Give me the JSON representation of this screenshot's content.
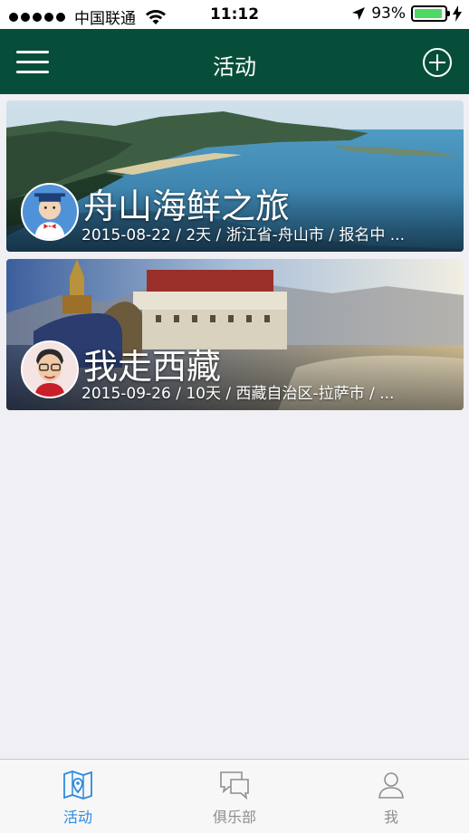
{
  "status_bar": {
    "carrier": "中国联通",
    "time": "11:12",
    "battery": "93%",
    "battery_level": 0.93
  },
  "nav": {
    "title": "活动",
    "menu_icon": "hamburger-icon",
    "add_icon": "plus-circle-icon"
  },
  "activities": [
    {
      "title": "舟山海鲜之旅",
      "meta": "2015-08-22 / 2天 /  浙江省-舟山市  /  报名中 ..."
    },
    {
      "title": "我走西藏",
      "meta": "2015-09-26 / 10天 /  西藏自治区-拉萨市  /  ..."
    }
  ],
  "tabs": [
    {
      "label": "活动",
      "icon": "map-pin-icon",
      "active": true
    },
    {
      "label": "俱乐部",
      "icon": "chat-bubbles-icon",
      "active": false
    },
    {
      "label": "我",
      "icon": "person-icon",
      "active": false
    }
  ],
  "colors": {
    "nav_bg": "#064e3a",
    "active_tab": "#2a8ae0",
    "inactive_tab": "#8e8e93",
    "page_bg": "#efeff4"
  }
}
